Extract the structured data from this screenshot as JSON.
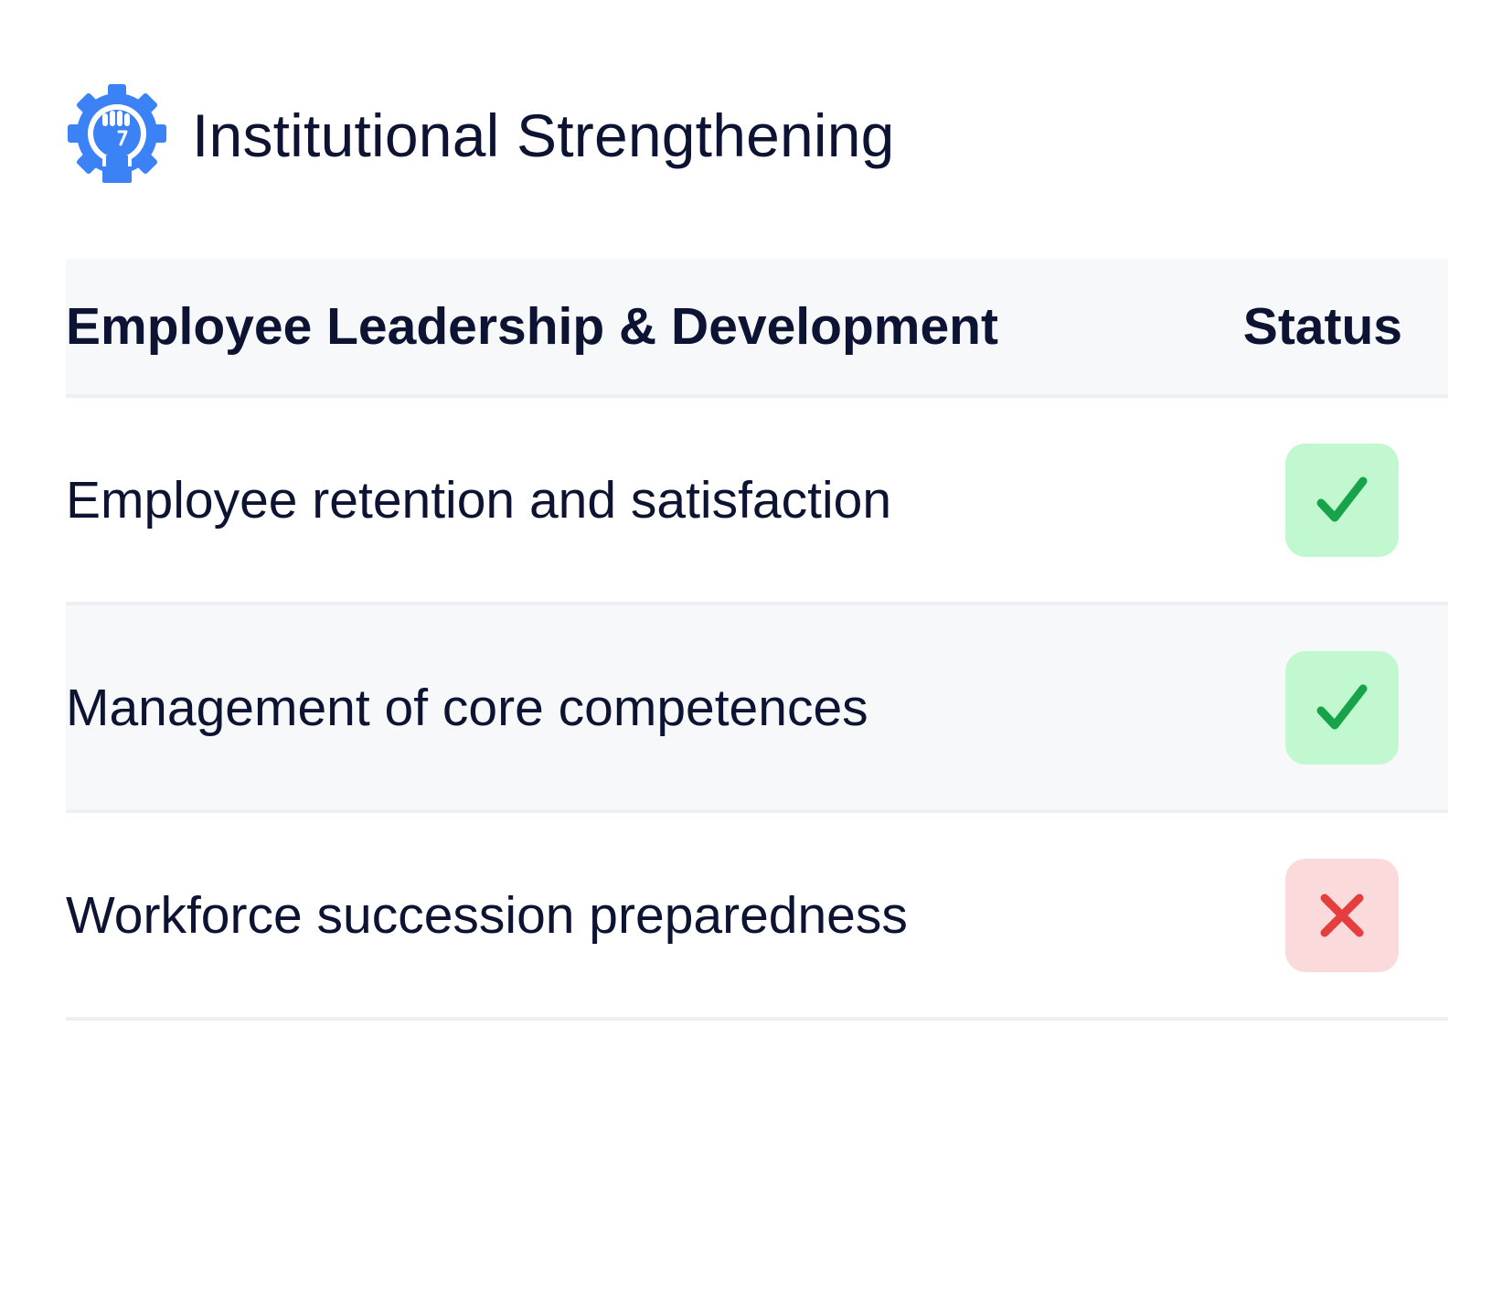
{
  "header": {
    "title": "Institutional Strengthening",
    "icon": "gear-fist-icon",
    "icon_color": "#3b82f6"
  },
  "table": {
    "columns": {
      "item": "Employee Leadership & Development",
      "status": "Status"
    },
    "rows": [
      {
        "label": "Employee retention and satisfaction",
        "status": "check",
        "status_color": "#16a34a",
        "badge_bg": "#c2f8cf"
      },
      {
        "label": "Management of core competences",
        "status": "check",
        "status_color": "#16a34a",
        "badge_bg": "#c2f8cf"
      },
      {
        "label": "Workforce succession preparedness",
        "status": "cross",
        "status_color": "#e53e3e",
        "badge_bg": "#fbdadb"
      }
    ]
  }
}
